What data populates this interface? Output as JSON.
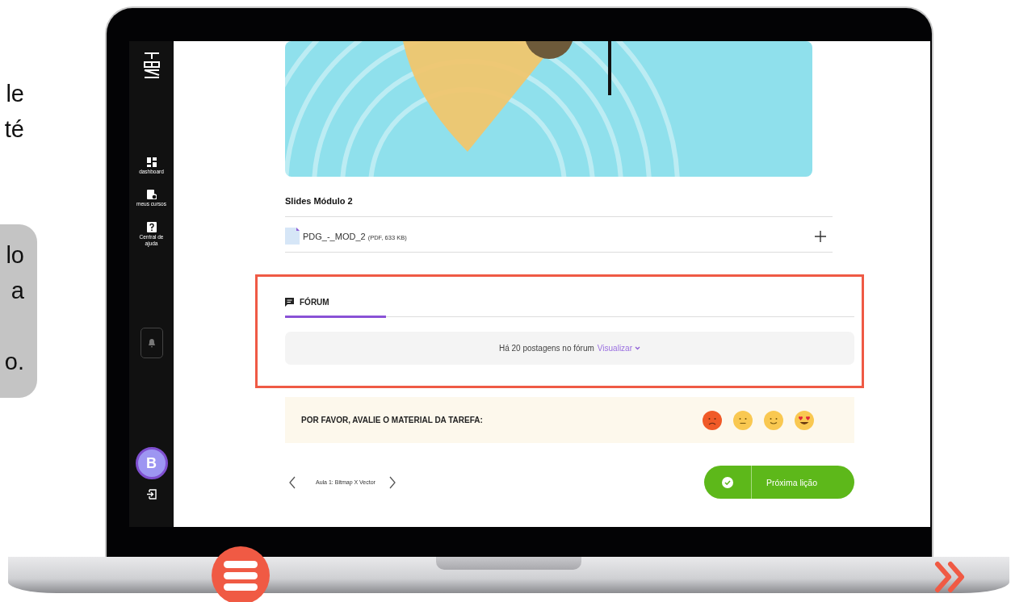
{
  "intro_text": {
    "lines": [
      "le",
      "té"
    ]
  },
  "callout": {
    "lines": [
      "lo",
      "a",
      "o."
    ]
  },
  "sidebar": {
    "items": [
      {
        "label": "dashboard",
        "kind": "dashboard"
      },
      {
        "label": "meus cursos",
        "kind": "courses"
      },
      {
        "label": "Central de ajuda",
        "kind": "help"
      }
    ],
    "avatar": "B"
  },
  "lesson": {
    "attachments_title": "Slides Módulo 2",
    "file": {
      "name": "PDG_-_MOD_2",
      "meta": "(PDF, 633 KB)"
    }
  },
  "forum": {
    "tabs": [
      {
        "label": "FÓRUM",
        "selected": true
      }
    ],
    "message": "Há 20 postagens no fórum",
    "link": "Visualizar"
  },
  "rating": {
    "prompt": "POR FAVOR, AVALIE O MATERIAL DA TAREFA:",
    "options": [
      {
        "kind": "sad"
      },
      {
        "kind": "neutral"
      },
      {
        "kind": "smile"
      },
      {
        "kind": "love"
      }
    ]
  },
  "navigation": {
    "lesson": "Aula 1: Bitmap X Vector",
    "next_button": "Próxima lição"
  }
}
